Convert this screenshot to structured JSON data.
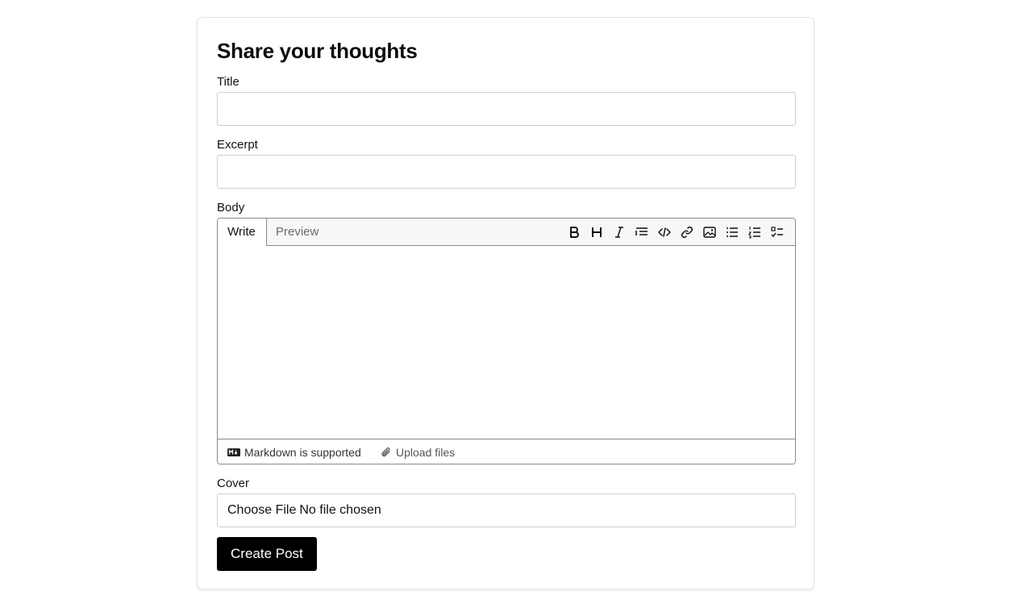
{
  "form": {
    "heading": "Share your thoughts",
    "title_label": "Title",
    "title_value": "",
    "excerpt_label": "Excerpt",
    "excerpt_value": "",
    "body_label": "Body",
    "cover_label": "Cover",
    "submit_label": "Create Post"
  },
  "editor": {
    "tabs": [
      {
        "label": "Write",
        "active": true
      },
      {
        "label": "Preview",
        "active": false
      }
    ],
    "toolbar": [
      {
        "icon": "bold-icon"
      },
      {
        "icon": "heading-icon"
      },
      {
        "icon": "italic-icon"
      },
      {
        "icon": "quote-icon"
      },
      {
        "icon": "code-icon"
      },
      {
        "icon": "link-icon"
      },
      {
        "icon": "image-icon"
      },
      {
        "icon": "bullet-list-icon"
      },
      {
        "icon": "numbered-list-icon"
      },
      {
        "icon": "task-list-icon"
      }
    ],
    "body_value": "",
    "footer": {
      "markdown_note": "Markdown is supported",
      "upload_label": "Upload files"
    }
  },
  "cover": {
    "button_label": "Choose File",
    "status": "No file chosen"
  }
}
